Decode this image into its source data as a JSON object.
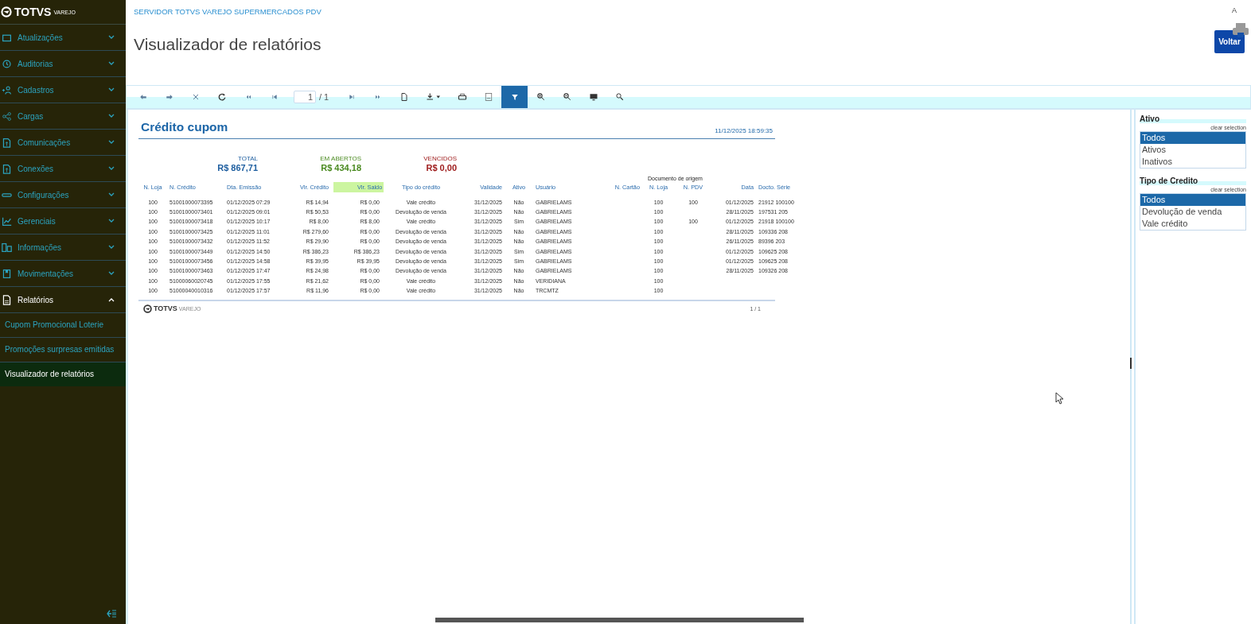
{
  "header": {
    "server": "SERVIDOR TOTVS VAREJO SUPERMERCADOS PDV",
    "title": "Visualizador de relatórios",
    "user": "A",
    "back_button": "Voltar"
  },
  "sidebar": {
    "logo": "TOTVS",
    "logo_sub": "VAREJO",
    "items": [
      {
        "label": "Atualizações",
        "expanded": false
      },
      {
        "label": "Auditorias",
        "expanded": false
      },
      {
        "label": "Cadastros",
        "expanded": false
      },
      {
        "label": "Cargas",
        "expanded": false
      },
      {
        "label": "Comunicações",
        "expanded": false
      },
      {
        "label": "Conexões",
        "expanded": false
      },
      {
        "label": "Configurações",
        "expanded": false
      },
      {
        "label": "Gerenciais",
        "expanded": false
      },
      {
        "label": "Informações",
        "expanded": false
      },
      {
        "label": "Movimentações",
        "expanded": false
      },
      {
        "label": "Relatórios",
        "expanded": true,
        "children": [
          {
            "label": "Cupom Promocional Loterie",
            "selected": false
          },
          {
            "label": "Promoções surpresas emitidas",
            "selected": false
          },
          {
            "label": "Visualizador de relatórios",
            "selected": true
          }
        ]
      }
    ]
  },
  "toolbar": {
    "page": "1",
    "page_total": "/ 1",
    "filter_on": true
  },
  "report": {
    "title": "Crédito cupom",
    "timestamp": "11/12/2025 18:59:35",
    "summaries": [
      {
        "label": "TOTAL",
        "value": "R$ 867,71",
        "color": "#1f5fa0"
      },
      {
        "label": "EM ABERTOS",
        "value": "R$ 434,18",
        "color": "#4a8a20"
      },
      {
        "label": "VENCIDOS",
        "value": "R$ 0,00",
        "color": "#a02020"
      }
    ],
    "group_label": "Documento de origem",
    "columns": [
      {
        "label": "N. Loja",
        "highlighted": false
      },
      {
        "label": "N. Crédito",
        "highlighted": false
      },
      {
        "label": "Dta. Emissão",
        "highlighted": false
      },
      {
        "label": "Vlr. Crédito",
        "highlighted": false
      },
      {
        "label": "Vlr. Saldo",
        "highlighted": true
      },
      {
        "label": "Tipo do crédito",
        "highlighted": false
      },
      {
        "label": "Validade",
        "highlighted": false
      },
      {
        "label": "Ativo",
        "highlighted": false
      },
      {
        "label": "Usuário",
        "highlighted": false
      },
      {
        "label": "N. Cartão",
        "highlighted": false
      },
      {
        "label": "N. Loja",
        "highlighted": false
      },
      {
        "label": "N. PDV",
        "highlighted": false
      },
      {
        "label": "Data",
        "highlighted": false
      },
      {
        "label": "Docto. Série",
        "highlighted": false
      }
    ],
    "rows": [
      [
        "100",
        "51001000073395",
        "01/12/2025 07:29",
        "R$ 14,94",
        "R$ 0,00",
        "Vale crédito",
        "31/12/2025",
        "Não",
        "GABRIELAMS",
        "",
        "100",
        "100",
        "01/12/2025",
        "21912 100100"
      ],
      [
        "100",
        "51001000073401",
        "01/12/2025 09:01",
        "R$ 50,53",
        "R$ 0,00",
        "Devolução de venda",
        "31/12/2025",
        "Não",
        "GABRIELAMS",
        "",
        "100",
        "",
        "28/11/2025",
        "197531 205"
      ],
      [
        "100",
        "51001000073418",
        "01/12/2025 10:17",
        "R$ 8,00",
        "R$ 8,00",
        "Vale crédito",
        "31/12/2025",
        "Sim",
        "GABRIELAMS",
        "",
        "100",
        "100",
        "01/12/2025",
        "21918 100100"
      ],
      [
        "100",
        "51001000073425",
        "01/12/2025 11:01",
        "R$ 279,60",
        "R$ 0,00",
        "Devolução de venda",
        "31/12/2025",
        "Não",
        "GABRIELAMS",
        "",
        "100",
        "",
        "28/11/2025",
        "109336 208"
      ],
      [
        "100",
        "51001000073432",
        "01/12/2025 11:52",
        "R$ 29,90",
        "R$ 0,00",
        "Devolução de venda",
        "31/12/2025",
        "Não",
        "GABRIELAMS",
        "",
        "100",
        "",
        "26/11/2025",
        "89396 203"
      ],
      [
        "100",
        "51001000073449",
        "01/12/2025 14:50",
        "R$ 386,23",
        "R$ 386,23",
        "Devolução de venda",
        "31/12/2025",
        "Sim",
        "GABRIELAMS",
        "",
        "100",
        "",
        "01/12/2025",
        "109625 208"
      ],
      [
        "100",
        "51001000073456",
        "01/12/2025 14:58",
        "R$ 39,95",
        "R$ 39,95",
        "Devolução de venda",
        "31/12/2025",
        "Sim",
        "GABRIELAMS",
        "",
        "100",
        "",
        "01/12/2025",
        "109625 208"
      ],
      [
        "100",
        "51001000073463",
        "01/12/2025 17:47",
        "R$ 24,98",
        "R$ 0,00",
        "Devolução de venda",
        "31/12/2025",
        "Não",
        "GABRIELAMS",
        "",
        "100",
        "",
        "28/11/2025",
        "109326 208"
      ],
      [
        "100",
        "51000060020745",
        "01/12/2025 17:55",
        "R$ 21,62",
        "R$ 0,00",
        "Vale crédito",
        "31/12/2025",
        "Não",
        "VERIDIANA",
        "",
        "100",
        "",
        "",
        ""
      ],
      [
        "100",
        "51000040010316",
        "01/12/2025 17:57",
        "R$ 11,96",
        "R$ 0,00",
        "Vale crédito",
        "31/12/2025",
        "Não",
        "TRCMTZ",
        "",
        "100",
        "",
        "",
        ""
      ]
    ],
    "footer_logo": "TOTVS",
    "footer_sub": "VAREJO",
    "page": "1 / 1"
  },
  "filters": [
    {
      "title": "Ativo",
      "clear": "clear selection",
      "options": [
        {
          "label": "Todos",
          "selected": true
        },
        {
          "label": "Ativos",
          "selected": false
        },
        {
          "label": "Inativos",
          "selected": false
        }
      ]
    },
    {
      "title": "Tipo de Credito",
      "clear": "clear selection",
      "options": [
        {
          "label": "Todos",
          "selected": true
        },
        {
          "label": "Devolução de venda",
          "selected": false
        },
        {
          "label": "Vale crédito",
          "selected": false
        }
      ]
    }
  ]
}
